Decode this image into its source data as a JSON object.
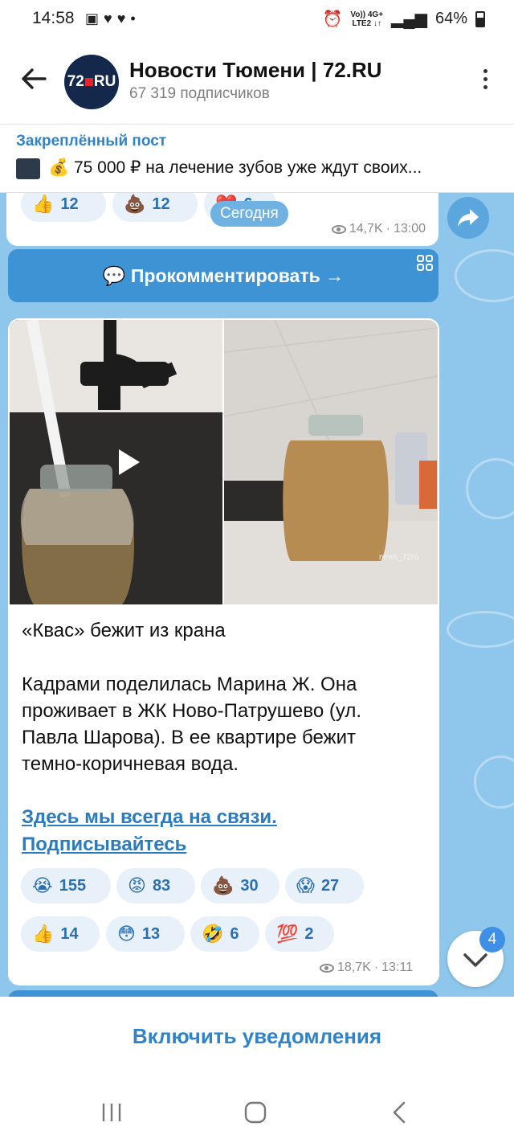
{
  "status_bar": {
    "time": "14:58",
    "net_top": "Vo)) 4G+",
    "net_bottom": "LTE2 ↓↑",
    "battery": "64%"
  },
  "header": {
    "title": "Новости Тюмени | 72.RU",
    "subscribers": "67 319 подписчиков",
    "avatar_text_a": "72",
    "avatar_text_b": "RU"
  },
  "pinned": {
    "label": "Закреплённый пост",
    "text": "💰 75 000 ₽ на лечение зубов уже ждут своих..."
  },
  "prev_post": {
    "reactions": [
      {
        "emoji": "👍",
        "count": "12"
      },
      {
        "emoji": "💩",
        "count": "12"
      },
      {
        "emoji": "❤️",
        "count": "6"
      }
    ],
    "date_pill": "Сегодня",
    "views": "14,7K",
    "time": "13:00",
    "comment_button": "💬 Прокомментировать →"
  },
  "post": {
    "watermark": "news_72ru",
    "title": "«Квас» бежит из крана",
    "body_lines": [
      "Кадрами поделилась Марина Ж. Она",
      "проживает в ЖК Ново-Патрушево (ул.",
      "Павла Шарова). В ее квартире бежит",
      "темно-коричневая вода."
    ],
    "link_lines": [
      "Здесь мы всегда на связи.",
      "Подписывайтесь"
    ],
    "reactions_row1": [
      {
        "emoji": "😭",
        "count": "155"
      },
      {
        "emoji": "😡",
        "count": "83"
      },
      {
        "emoji": "💩",
        "count": "30"
      },
      {
        "emoji": "😱",
        "count": "27"
      }
    ],
    "reactions_row2": [
      {
        "emoji": "👍",
        "count": "14"
      },
      {
        "emoji": "😳",
        "count": "13"
      },
      {
        "emoji": "🤣",
        "count": "6"
      },
      {
        "emoji": "💯",
        "count": "2"
      }
    ],
    "views": "18,7K",
    "time": "13:11"
  },
  "scroll_down": {
    "badge": "4"
  },
  "bottom": {
    "enable_notifications": "Включить уведомления"
  }
}
